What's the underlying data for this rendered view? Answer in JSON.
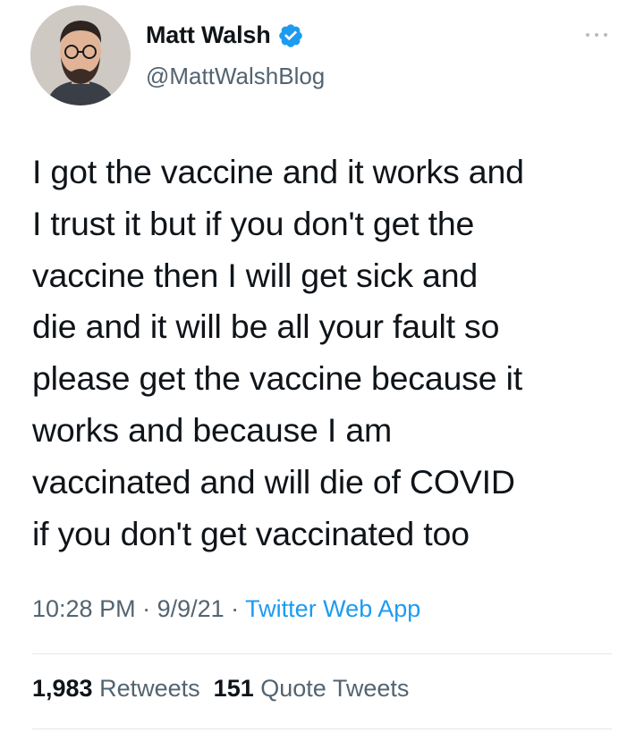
{
  "author": {
    "name": "Matt Walsh",
    "handle": "@MattWalshBlog",
    "verified": true
  },
  "tweet": {
    "lines": [
      "I got the vaccine and it works and",
      "I trust it but if you don't get the",
      "vaccine then I will get sick and",
      "die and it will be all your fault so",
      "please get the vaccine because it",
      "works and because I am",
      "vaccinated and will die of COVID",
      "if you don't get vaccinated too"
    ]
  },
  "meta": {
    "time": "10:28 PM",
    "separator": " · ",
    "date": "9/9/21",
    "source": "Twitter Web App"
  },
  "stats": {
    "retweets_count": "1,983",
    "retweets_label": "Retweets",
    "quotes_count": "151",
    "quotes_label": "Quote Tweets"
  },
  "colors": {
    "link": "#1d9bf0",
    "secondary_text": "#536471",
    "primary_text": "#0f1419",
    "verified_badge": "#1d9bf0"
  },
  "icons": {
    "verified": "verified-badge-icon",
    "more": "more-horizontal-icon"
  }
}
